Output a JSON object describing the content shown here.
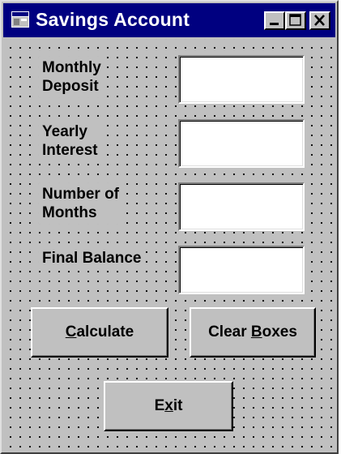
{
  "window": {
    "title": "Savings Account"
  },
  "form": {
    "labels": {
      "monthly_deposit": [
        "Monthly",
        "Deposit"
      ],
      "yearly_interest": [
        "Yearly",
        "Interest"
      ],
      "number_of_months": [
        "Number of",
        "Months"
      ],
      "final_balance": "Final Balance"
    },
    "fields": {
      "monthly_deposit": "",
      "yearly_interest": "",
      "number_of_months": "",
      "final_balance": ""
    }
  },
  "buttons": {
    "calculate": {
      "accel": "C",
      "rest": "alculate"
    },
    "clear_boxes": {
      "pre": "Clear ",
      "accel": "B",
      "rest": "oxes"
    },
    "exit": {
      "pre": "E",
      "accel": "x",
      "rest": "it"
    }
  },
  "icons": {
    "app": "app-window-icon",
    "minimize": "minimize-icon",
    "maximize": "maximize-icon",
    "close": "close-icon"
  },
  "colors": {
    "titlebar": "#000080",
    "face": "#c0c0c0"
  }
}
